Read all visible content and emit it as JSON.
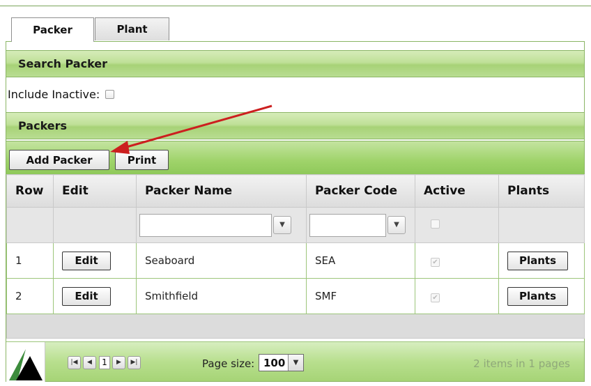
{
  "tabs": [
    {
      "label": "Packer",
      "active": true
    },
    {
      "label": "Plant",
      "active": false
    }
  ],
  "search": {
    "header": "Search Packer",
    "include_inactive_label": "Include Inactive:",
    "include_inactive_checked": false
  },
  "packers": {
    "header": "Packers",
    "add_button": "Add Packer",
    "print_button": "Print"
  },
  "grid": {
    "columns": [
      "Row",
      "Edit",
      "Packer Name",
      "Packer Code",
      "Active",
      "Plants"
    ],
    "edit_label": "Edit",
    "plants_label": "Plants",
    "rows": [
      {
        "row": "1",
        "name": "Seaboard",
        "code": "SEA",
        "active": true
      },
      {
        "row": "2",
        "name": "Smithfield",
        "code": "SMF",
        "active": true
      }
    ]
  },
  "pager": {
    "current_page": "1",
    "page_size_label": "Page size:",
    "page_size": "100",
    "info": "2 items in 1 pages"
  },
  "colors": {
    "accent": "#a6d476",
    "arrow": "#cc1f1f"
  }
}
